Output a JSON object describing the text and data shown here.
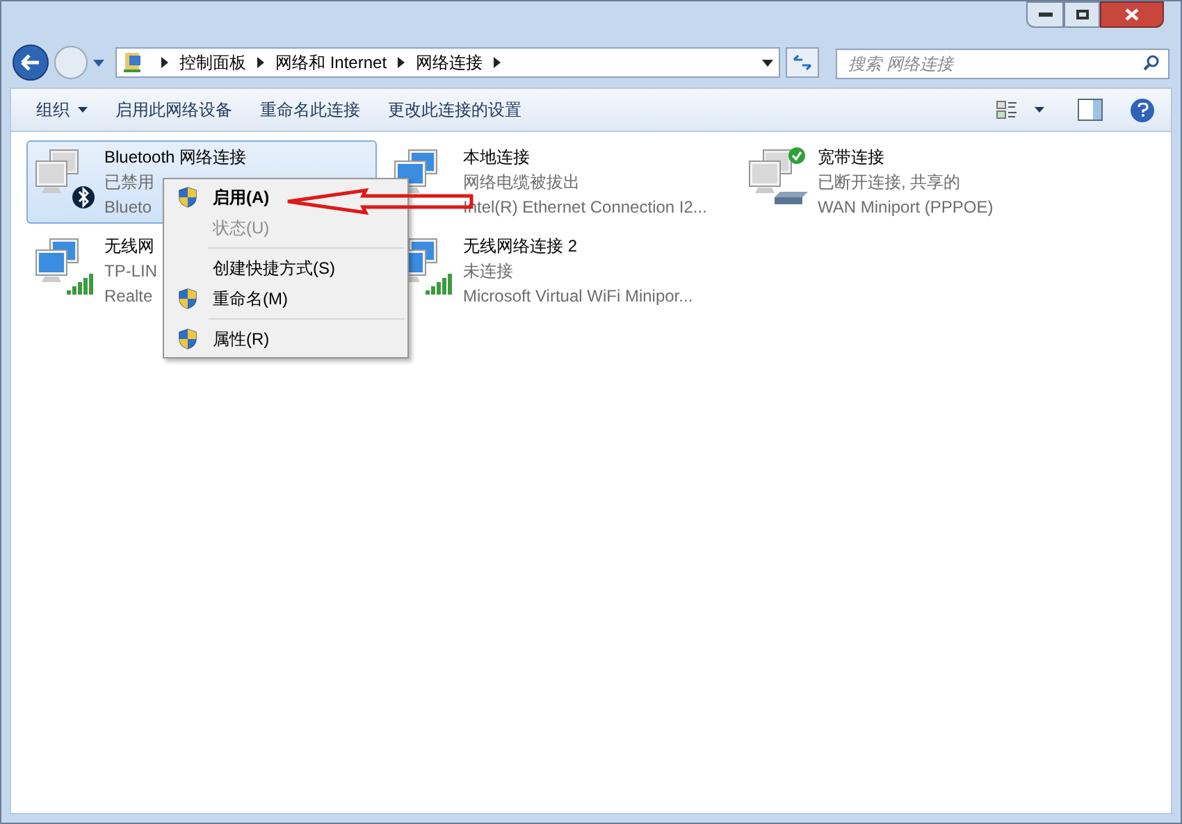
{
  "address_bar": {
    "breadcrumbs": [
      "控制面板",
      "网络和 Internet",
      "网络连接"
    ]
  },
  "search": {
    "placeholder": "搜索 网络连接"
  },
  "toolbar": {
    "buttons": [
      {
        "label": "组织",
        "dropdown": true
      },
      {
        "label": "启用此网络设备",
        "dropdown": false
      },
      {
        "label": "重命名此连接",
        "dropdown": false
      },
      {
        "label": "更改此连接的设置",
        "dropdown": false
      }
    ]
  },
  "connections": [
    {
      "name": "Bluetooth 网络连接",
      "status": "已禁用",
      "device": "Blueto",
      "kind": "bluetooth",
      "selected": true
    },
    {
      "name": "本地连接",
      "status": "网络电缆被拔出",
      "device": "Intel(R) Ethernet Connection I2...",
      "kind": "unplugged",
      "selected": false
    },
    {
      "name": "宽带连接",
      "status": "已断开连接, 共享的",
      "device": "WAN Miniport (PPPOE)",
      "kind": "modem",
      "selected": false
    },
    {
      "name": "无线网",
      "status": "TP-LIN",
      "device": "Realte",
      "kind": "signal",
      "selected": false
    },
    {
      "name": "无线网络连接 2",
      "status": "未连接",
      "device": "Microsoft Virtual WiFi Minipor...",
      "kind": "signal",
      "selected": false
    }
  ],
  "context_menu": [
    {
      "kind": "item",
      "label": "启用(A)",
      "shield": true,
      "bold": true,
      "disabled": false
    },
    {
      "kind": "item",
      "label": "状态(U)",
      "shield": false,
      "bold": false,
      "disabled": true
    },
    {
      "kind": "separator"
    },
    {
      "kind": "item",
      "label": "创建快捷方式(S)",
      "shield": false,
      "bold": false,
      "disabled": false
    },
    {
      "kind": "item",
      "label": "重命名(M)",
      "shield": true,
      "bold": false,
      "disabled": false
    },
    {
      "kind": "separator"
    },
    {
      "kind": "item",
      "label": "属性(R)",
      "shield": true,
      "bold": false,
      "disabled": false
    }
  ]
}
